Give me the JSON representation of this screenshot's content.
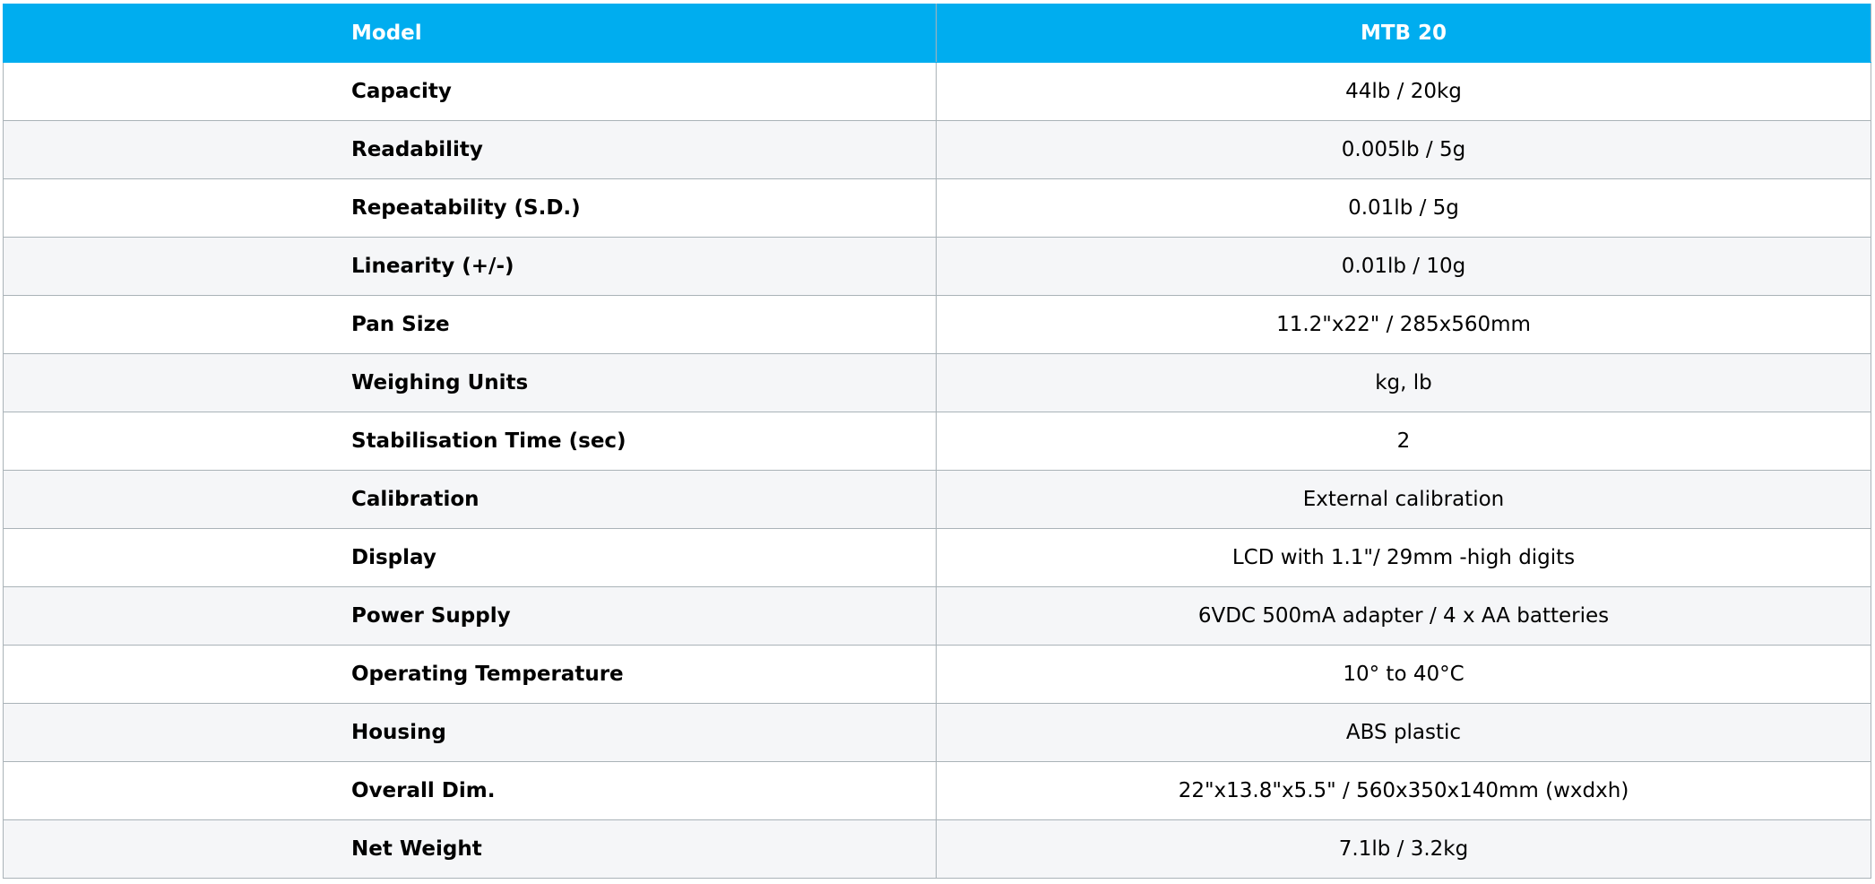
{
  "header": {
    "col1": "Model",
    "col2": "MTB 20"
  },
  "rows": [
    {
      "label": "Capacity",
      "value": "44lb / 20kg"
    },
    {
      "label": "Readability",
      "value": "0.005lb / 5g"
    },
    {
      "label": "Repeatability (S.D.)",
      "value": "0.01lb / 5g"
    },
    {
      "label": "Linearity (+/-)",
      "value": "0.01lb / 10g"
    },
    {
      "label": "Pan Size",
      "value": "11.2\"x22\" / 285x560mm"
    },
    {
      "label": "Weighing Units",
      "value": "kg, lb"
    },
    {
      "label": "Stabilisation Time (sec)",
      "value": "2"
    },
    {
      "label": "Calibration",
      "value": "External calibration"
    },
    {
      "label": "Display",
      "value": "LCD with 1.1\"/ 29mm -high digits"
    },
    {
      "label": "Power Supply",
      "value": "6VDC 500mA adapter / 4 x AA batteries"
    },
    {
      "label": "Operating Temperature",
      "value": "10° to 40°C"
    },
    {
      "label": "Housing",
      "value": "ABS plastic"
    },
    {
      "label": "Overall Dim.",
      "value": "22\"x13.8\"x5.5\" / 560x350x140mm (wxdxh)"
    },
    {
      "label": "Net Weight",
      "value": "7.1lb / 3.2kg"
    }
  ],
  "colors": {
    "header_bg": "#00adef",
    "header_text": "#ffffff",
    "stripe_bg": "#f5f6f8",
    "border": "#aab3b8"
  }
}
